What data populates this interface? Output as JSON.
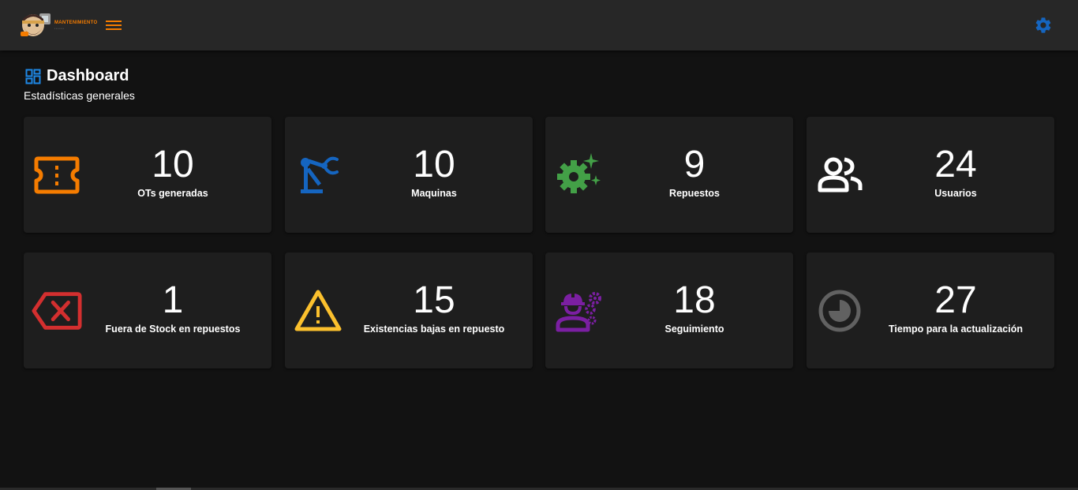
{
  "header": {
    "logo_title": "MANTENIMIENTO",
    "logo_sub": "• • • • • • •",
    "menu_icon": "hamburger-menu-icon",
    "settings_icon": "gear-icon",
    "accent_color": "#f57c00",
    "settings_color": "#1565c0"
  },
  "page": {
    "title": "Dashboard",
    "subtitle": "Estadísticas generales",
    "title_icon": "dashboard-icon"
  },
  "cards": [
    {
      "value": "10",
      "label": "OTs generadas",
      "icon": "ticket-icon",
      "color": "#f57c00"
    },
    {
      "value": "10",
      "label": "Maquinas",
      "icon": "robot-arm-icon",
      "color": "#1565c0"
    },
    {
      "value": "9",
      "label": "Repuestos",
      "icon": "gear-sparkle-icon",
      "color": "#43a047"
    },
    {
      "value": "24",
      "label": "Usuarios",
      "icon": "users-icon",
      "color": "#ffffff"
    },
    {
      "value": "1",
      "label": "Fuera de Stock en repuestos",
      "icon": "backspace-x-icon",
      "color": "#d32f2f"
    },
    {
      "value": "15",
      "label": "Existencias bajas en repuesto",
      "icon": "warning-icon",
      "color": "#fbc02d"
    },
    {
      "value": "18",
      "label": "Seguimiento",
      "icon": "engineer-gears-icon",
      "color": "#7b1fa2"
    },
    {
      "value": "27",
      "label": "Tiempo para la actualización",
      "icon": "timer-pie-icon",
      "color": "#616161"
    }
  ]
}
